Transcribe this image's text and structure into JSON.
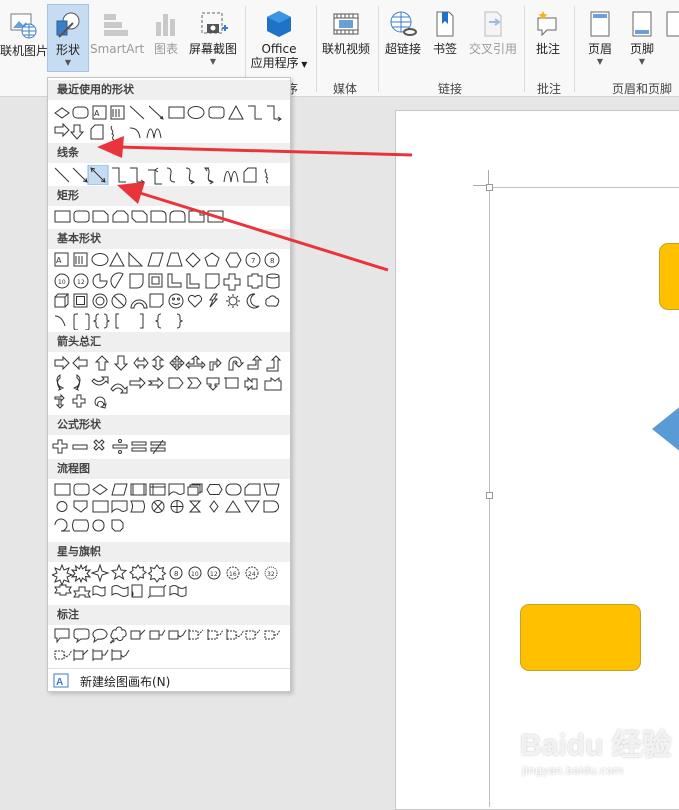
{
  "ribbon": {
    "buttons": [
      {
        "id": "online-pictures",
        "label": "联机图片"
      },
      {
        "id": "shapes",
        "label": "形状"
      },
      {
        "id": "smartart",
        "label": "SmartArt"
      },
      {
        "id": "chart",
        "label": "图表"
      },
      {
        "id": "screenshot",
        "label": "屏幕截图"
      },
      {
        "id": "office-apps",
        "label": "Office",
        "label2": "应用程序"
      },
      {
        "id": "online-video",
        "label": "联机视频"
      },
      {
        "id": "hyperlink",
        "label": "超链接"
      },
      {
        "id": "bookmark",
        "label": "书签"
      },
      {
        "id": "cross-reference",
        "label": "交叉引用"
      },
      {
        "id": "comment",
        "label": "批注"
      },
      {
        "id": "header",
        "label": "页眉"
      },
      {
        "id": "footer",
        "label": "页脚"
      }
    ],
    "groups": {
      "apps_suffix": "序",
      "media": "媒体",
      "links": "链接",
      "comments": "批注",
      "header_footer": "页眉和页脚"
    }
  },
  "dropdown": {
    "sections": {
      "recent": "最近使用的形状",
      "lines": "线条",
      "rectangles": "矩形",
      "basic": "基本形状",
      "arrows": "箭头总汇",
      "equation": "公式形状",
      "flowchart": "流程图",
      "stars": "星与旗帜",
      "callouts": "标注"
    },
    "new_canvas_label": "新建绘图画布(N)"
  },
  "watermark": {
    "brand": "Baidu 经验",
    "url": "jingyan.baidu.com"
  },
  "colors": {
    "accent_blue": "#5b9bd5",
    "shape_yellow": "#ffc000",
    "arrow_red": "#e8343a",
    "ribbon_bg": "#f8f8f8",
    "selected_bg": "#c6dcf3"
  }
}
